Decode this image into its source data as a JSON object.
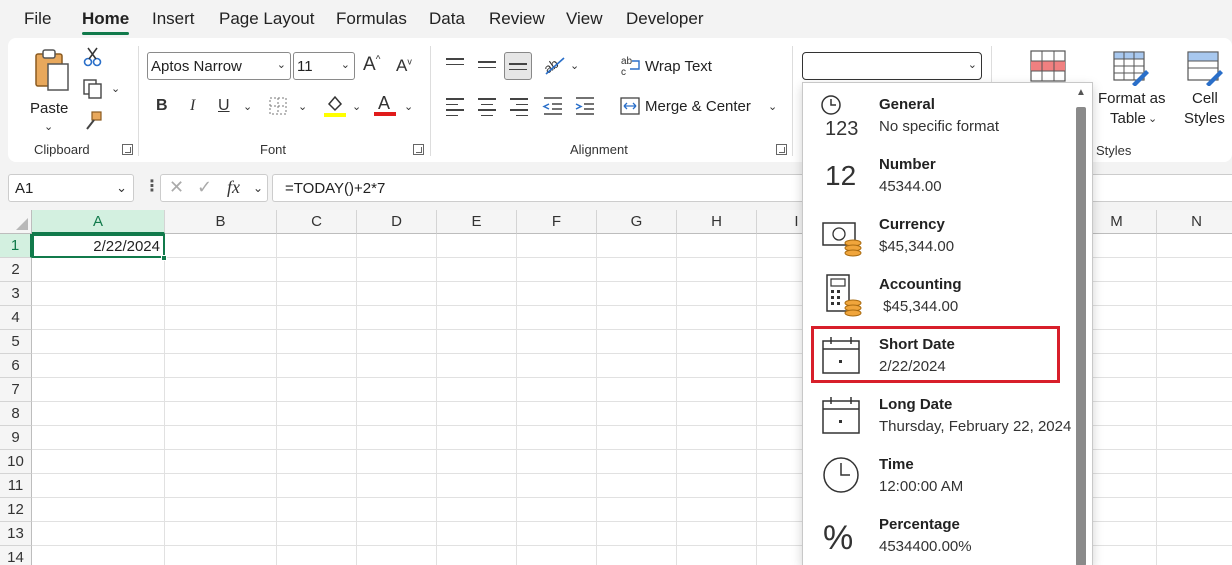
{
  "menu": {
    "tabs": [
      "File",
      "Home",
      "Insert",
      "Page Layout",
      "Formulas",
      "Data",
      "Review",
      "View",
      "Developer"
    ],
    "active": "Home"
  },
  "ribbon": {
    "clipboard": {
      "paste_label": "Paste",
      "group_label": "Clipboard"
    },
    "font": {
      "font_name": "Aptos Narrow",
      "font_size": "11",
      "group_label": "Font",
      "fill_color": "#ffff00",
      "font_color": "#e01b1b"
    },
    "alignment": {
      "wrap_text_label": "Wrap Text",
      "merge_center_label": "Merge & Center",
      "group_label": "Alignment"
    },
    "number": {
      "format_value": ""
    },
    "styles": {
      "format_as_table_line1": "Format as",
      "format_as_table_line2": "Table",
      "cell_styles_line1": "Cell",
      "cell_styles_line2": "Styles",
      "group_label": "Styles"
    }
  },
  "formula_bar": {
    "name_box": "A1",
    "formula": "=TODAY()+2*7"
  },
  "sheet": {
    "columns": [
      "A",
      "B",
      "C",
      "D",
      "E",
      "F",
      "G",
      "H",
      "I",
      "M",
      "N"
    ],
    "rows": [
      "1",
      "2",
      "3",
      "4",
      "5",
      "6",
      "7",
      "8",
      "9",
      "10",
      "11",
      "12",
      "13",
      "14"
    ],
    "selected_cell_value": "2/22/2024"
  },
  "number_format_menu": {
    "options": [
      {
        "title": "General",
        "sample": "No specific format",
        "icon": "clock-123-icon"
      },
      {
        "title": "Number",
        "sample": "45344.00",
        "icon": "number-12-icon"
      },
      {
        "title": "Currency",
        "sample": "$45,344.00",
        "icon": "currency-icon"
      },
      {
        "title": "Accounting",
        "sample": " $45,344.00",
        "icon": "accounting-icon"
      },
      {
        "title": "Short Date",
        "sample": "2/22/2024",
        "icon": "calendar-icon"
      },
      {
        "title": "Long Date",
        "sample": "Thursday, February 22, 2024",
        "icon": "calendar-icon"
      },
      {
        "title": "Time",
        "sample": "12:00:00 AM",
        "icon": "clock-icon"
      },
      {
        "title": "Percentage",
        "sample": "4534400.00%",
        "icon": "percent-icon"
      }
    ],
    "highlighted": "Short Date",
    "highlight_color": "#d81f2a"
  },
  "colors": {
    "accent": "#117a4b"
  }
}
